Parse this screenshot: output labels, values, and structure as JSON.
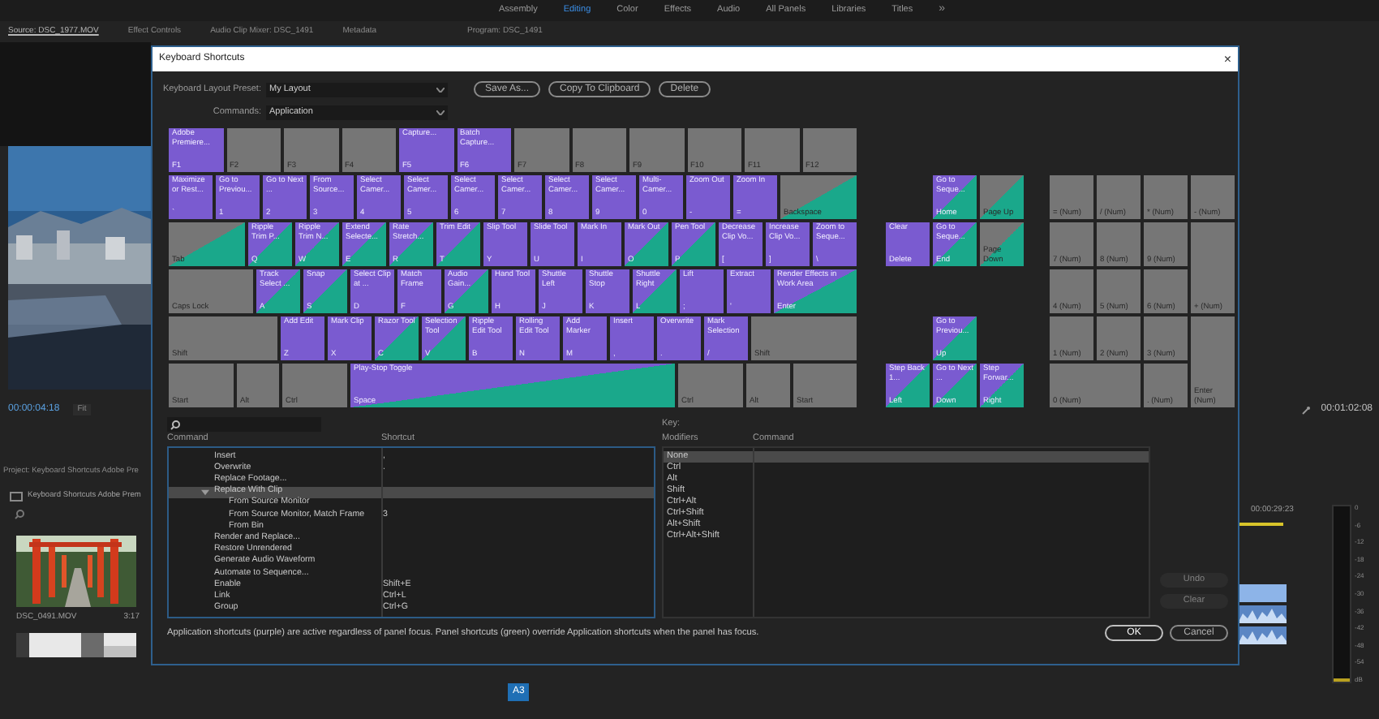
{
  "workspace_tabs": [
    {
      "label": "Assembly",
      "selected": false
    },
    {
      "label": "Editing",
      "selected": true
    },
    {
      "label": "Color",
      "selected": false
    },
    {
      "label": "Effects",
      "selected": false
    },
    {
      "label": "Audio",
      "selected": false
    },
    {
      "label": "All Panels",
      "selected": false
    },
    {
      "label": "Libraries",
      "selected": false
    },
    {
      "label": "Titles",
      "selected": false
    }
  ],
  "more_workspaces": "»",
  "panel_tabs": [
    {
      "label": "Source: DSC_1977.MOV",
      "selected": true
    },
    {
      "label": "Effect Controls",
      "selected": false
    },
    {
      "label": "Audio Clip Mixer: DSC_1491",
      "selected": false
    },
    {
      "label": "Metadata",
      "selected": false
    }
  ],
  "program_tab": {
    "label": "Program: DSC_1491"
  },
  "source_monitor": {
    "timecode": "00:00:04:18",
    "zoom": "Fit"
  },
  "project_panel": {
    "tab": "Project: Keyboard Shortcuts Adobe Pre",
    "bin": "Keyboard Shortcuts Adobe Prem",
    "clips": [
      {
        "name": "DSC_0491.MOV",
        "duration": "3:17"
      }
    ]
  },
  "timeline": {
    "timecode": "00:01:02:08",
    "playhead_time": "00:00:29:23",
    "track_button": "A3"
  },
  "audio_meter": {
    "scale": [
      "0",
      "-6",
      "-12",
      "-18",
      "-24",
      "-30",
      "-36",
      "-42",
      "-48",
      "-54",
      "dB"
    ]
  },
  "dialog": {
    "title": "Keyboard Shortcuts",
    "close": "×",
    "preset_label": "Keyboard Layout Preset:",
    "preset": "My Layout",
    "buttons": [
      "Save As...",
      "Copy To Clipboard",
      "Delete"
    ],
    "commands_label": "Commands:",
    "commands": "Application",
    "keyboard": {
      "function_row": [
        {
          "label": "F1",
          "command": "Adobe Premiere...",
          "kind": "app"
        },
        {
          "label": "F2",
          "kind": "none"
        },
        {
          "label": "F3",
          "kind": "none"
        },
        {
          "label": "F4",
          "kind": "none"
        },
        {
          "label": "F5",
          "command": "Capture...",
          "kind": "app"
        },
        {
          "label": "F6",
          "command": "Batch Capture...",
          "kind": "app"
        },
        {
          "label": "F7",
          "kind": "none"
        },
        {
          "label": "F8",
          "kind": "none"
        },
        {
          "label": "F9",
          "kind": "none"
        },
        {
          "label": "F10",
          "kind": "none"
        },
        {
          "label": "F11",
          "kind": "none"
        },
        {
          "label": "F12",
          "kind": "none"
        }
      ],
      "number_row": [
        {
          "label": "`",
          "command": "Maximize or Rest...",
          "kind": "app"
        },
        {
          "label": "1",
          "command": "Go to Previou...",
          "kind": "app"
        },
        {
          "label": "2",
          "command": "Go to Next ...",
          "kind": "app"
        },
        {
          "label": "3",
          "command": "From Source...",
          "kind": "app"
        },
        {
          "label": "4",
          "command": "Select Camer...",
          "kind": "app"
        },
        {
          "label": "5",
          "command": "Select Camer...",
          "kind": "app"
        },
        {
          "label": "6",
          "command": "Select Camer...",
          "kind": "app"
        },
        {
          "label": "7",
          "command": "Select Camer...",
          "kind": "app"
        },
        {
          "label": "8",
          "command": "Select Camer...",
          "kind": "app"
        },
        {
          "label": "9",
          "command": "Select Camer...",
          "kind": "app"
        },
        {
          "label": "0",
          "command": "Multi-Camer...",
          "kind": "app"
        },
        {
          "label": "-",
          "command": "Zoom Out",
          "kind": "app"
        },
        {
          "label": "=",
          "command": "Zoom In",
          "kind": "app"
        },
        {
          "label": "Backspace",
          "kind": "panel"
        }
      ],
      "top_row": [
        {
          "label": "Tab",
          "kind": "panel"
        },
        {
          "label": "Q",
          "command": "Ripple Trim P...",
          "kind": "both"
        },
        {
          "label": "W",
          "command": "Ripple Trim N...",
          "kind": "both"
        },
        {
          "label": "E",
          "command": "Extend Selecte...",
          "kind": "both"
        },
        {
          "label": "R",
          "command": "Rate Stretch...",
          "kind": "both"
        },
        {
          "label": "T",
          "command": "Trim Edit",
          "kind": "both"
        },
        {
          "label": "Y",
          "command": "Slip Tool",
          "kind": "app"
        },
        {
          "label": "U",
          "command": "Slide Tool",
          "kind": "app"
        },
        {
          "label": "I",
          "command": "Mark In",
          "kind": "app"
        },
        {
          "label": "O",
          "command": "Mark Out",
          "kind": "both"
        },
        {
          "label": "P",
          "command": "Pen Tool",
          "kind": "both"
        },
        {
          "label": "[",
          "command": "Decrease Clip Vo...",
          "kind": "app"
        },
        {
          "label": "]",
          "command": "Increase Clip Vo...",
          "kind": "app"
        },
        {
          "label": "\\",
          "command": "Zoom to Seque...",
          "kind": "app"
        }
      ],
      "home_row": [
        {
          "label": "Caps Lock",
          "kind": "none"
        },
        {
          "label": "A",
          "command": "Track Select ...",
          "kind": "both"
        },
        {
          "label": "S",
          "command": "Snap",
          "kind": "both"
        },
        {
          "label": "D",
          "command": "Select Clip at ...",
          "kind": "app"
        },
        {
          "label": "F",
          "command": "Match Frame",
          "kind": "app"
        },
        {
          "label": "G",
          "command": "Audio Gain...",
          "kind": "both"
        },
        {
          "label": "H",
          "command": "Hand Tool",
          "kind": "app"
        },
        {
          "label": "J",
          "command": "Shuttle Left",
          "kind": "app"
        },
        {
          "label": "K",
          "command": "Shuttle Stop",
          "kind": "app"
        },
        {
          "label": "L",
          "command": "Shuttle Right",
          "kind": "both"
        },
        {
          "label": ";",
          "command": "Lift",
          "kind": "app"
        },
        {
          "label": "'",
          "command": "Extract",
          "kind": "app"
        },
        {
          "label": "Enter",
          "command": "Render Effects in Work Area",
          "kind": "both"
        }
      ],
      "bottom_row": [
        {
          "label": "Shift",
          "kind": "none"
        },
        {
          "label": "Z",
          "command": "Add Edit",
          "kind": "app"
        },
        {
          "label": "X",
          "command": "Mark Clip",
          "kind": "app"
        },
        {
          "label": "C",
          "command": "Razor Tool",
          "kind": "both"
        },
        {
          "label": "V",
          "command": "Selection Tool",
          "kind": "both"
        },
        {
          "label": "B",
          "command": "Ripple Edit Tool",
          "kind": "app"
        },
        {
          "label": "N",
          "command": "Rolling Edit Tool",
          "kind": "app"
        },
        {
          "label": "M",
          "command": "Add Marker",
          "kind": "app"
        },
        {
          "label": ",",
          "command": "Insert",
          "kind": "app"
        },
        {
          "label": ".",
          "command": "Overwrite",
          "kind": "app"
        },
        {
          "label": "/",
          "command": "Mark Selection",
          "kind": "app"
        },
        {
          "label": "Shift",
          "kind": "none"
        }
      ],
      "modifier_row": [
        {
          "label": "Start",
          "kind": "none"
        },
        {
          "label": "Alt",
          "kind": "none"
        },
        {
          "label": "Ctrl",
          "kind": "none"
        },
        {
          "label": "Space",
          "command": "Play-Stop Toggle",
          "kind": "both"
        },
        {
          "label": "Ctrl",
          "kind": "none"
        },
        {
          "label": "Alt",
          "kind": "none"
        },
        {
          "label": "Start",
          "kind": "none"
        }
      ],
      "nav_keys": [
        {
          "label": "Home",
          "command": "Go to Seque...",
          "kind": "both"
        },
        {
          "label": "Page Up",
          "kind": "panel"
        },
        {
          "label": "Delete",
          "command": "Clear",
          "kind": "app"
        },
        {
          "label": "End",
          "command": "Go to Seque...",
          "kind": "both"
        },
        {
          "label": "Page Down",
          "kind": "panel"
        },
        {
          "label": "Up",
          "command": "Go to Previou...",
          "kind": "both"
        },
        {
          "label": "Left",
          "command": "Step Back 1...",
          "kind": "both"
        },
        {
          "label": "Down",
          "command": "Go to Next ...",
          "kind": "both"
        },
        {
          "label": "Right",
          "command": "Step Forwar...",
          "kind": "both"
        }
      ],
      "numpad": [
        {
          "label": "= (Num)",
          "kind": "none"
        },
        {
          "label": "/ (Num)",
          "kind": "none"
        },
        {
          "label": "* (Num)",
          "kind": "none"
        },
        {
          "label": "- (Num)",
          "kind": "none"
        },
        {
          "label": "7 (Num)",
          "kind": "none"
        },
        {
          "label": "8 (Num)",
          "kind": "none"
        },
        {
          "label": "9 (Num)",
          "kind": "none"
        },
        {
          "label": "4 (Num)",
          "kind": "none"
        },
        {
          "label": "5 (Num)",
          "kind": "none"
        },
        {
          "label": "6 (Num)",
          "kind": "none"
        },
        {
          "label": "+ (Num)",
          "kind": "none"
        },
        {
          "label": "1 (Num)",
          "kind": "none"
        },
        {
          "label": "2 (Num)",
          "kind": "none"
        },
        {
          "label": "3 (Num)",
          "kind": "none"
        },
        {
          "label": "0 (Num)",
          "kind": "none"
        },
        {
          "label": ". (Num)",
          "kind": "none"
        },
        {
          "label": "Enter (Num)",
          "kind": "none"
        }
      ]
    },
    "command_columns": [
      "Command",
      "Shortcut"
    ],
    "commands_list": [
      {
        "command": "Insert",
        "shortcut": ",",
        "selected": false
      },
      {
        "command": "Overwrite",
        "shortcut": ".",
        "selected": false
      },
      {
        "command": "Replace Footage...",
        "selected": false
      },
      {
        "command": "Replace With Clip",
        "selected": true,
        "expanded": true,
        "children": [
          {
            "command": "From Source Monitor",
            "selected": false
          },
          {
            "command": "From Source Monitor, Match Frame",
            "shortcut": "3",
            "selected": false
          },
          {
            "command": "From Bin",
            "selected": false
          }
        ]
      },
      {
        "command": "Render and Replace...",
        "selected": false
      },
      {
        "command": "Restore Unrendered",
        "selected": false
      },
      {
        "command": "Generate Audio Waveform",
        "selected": false
      },
      {
        "command": "Automate to Sequence...",
        "selected": false
      },
      {
        "command": "Enable",
        "shortcut": "Shift+E",
        "selected": false
      },
      {
        "command": "Link",
        "shortcut": "Ctrl+L",
        "selected": false
      },
      {
        "command": "Group",
        "shortcut": "Ctrl+G",
        "selected": false
      }
    ],
    "key_label": "Key:",
    "modifier_columns": [
      "Modifiers",
      "Command"
    ],
    "modifiers": [
      {
        "label": "None",
        "selected": true
      },
      {
        "label": "Ctrl",
        "selected": false
      },
      {
        "label": "Alt",
        "selected": false
      },
      {
        "label": "Shift",
        "selected": false
      },
      {
        "label": "Ctrl+Alt",
        "selected": false
      },
      {
        "label": "Ctrl+Shift",
        "selected": false
      },
      {
        "label": "Alt+Shift",
        "selected": false
      },
      {
        "label": "Ctrl+Alt+Shift",
        "selected": false
      }
    ],
    "side_buttons": [
      {
        "label": "Undo",
        "disabled": true
      },
      {
        "label": "Clear",
        "disabled": true
      }
    ],
    "note": "Application shortcuts (purple) are active regardless of panel focus. Panel shortcuts (green) override Application shortcuts when the panel has focus.",
    "footer_buttons": [
      "OK",
      "Cancel"
    ]
  }
}
